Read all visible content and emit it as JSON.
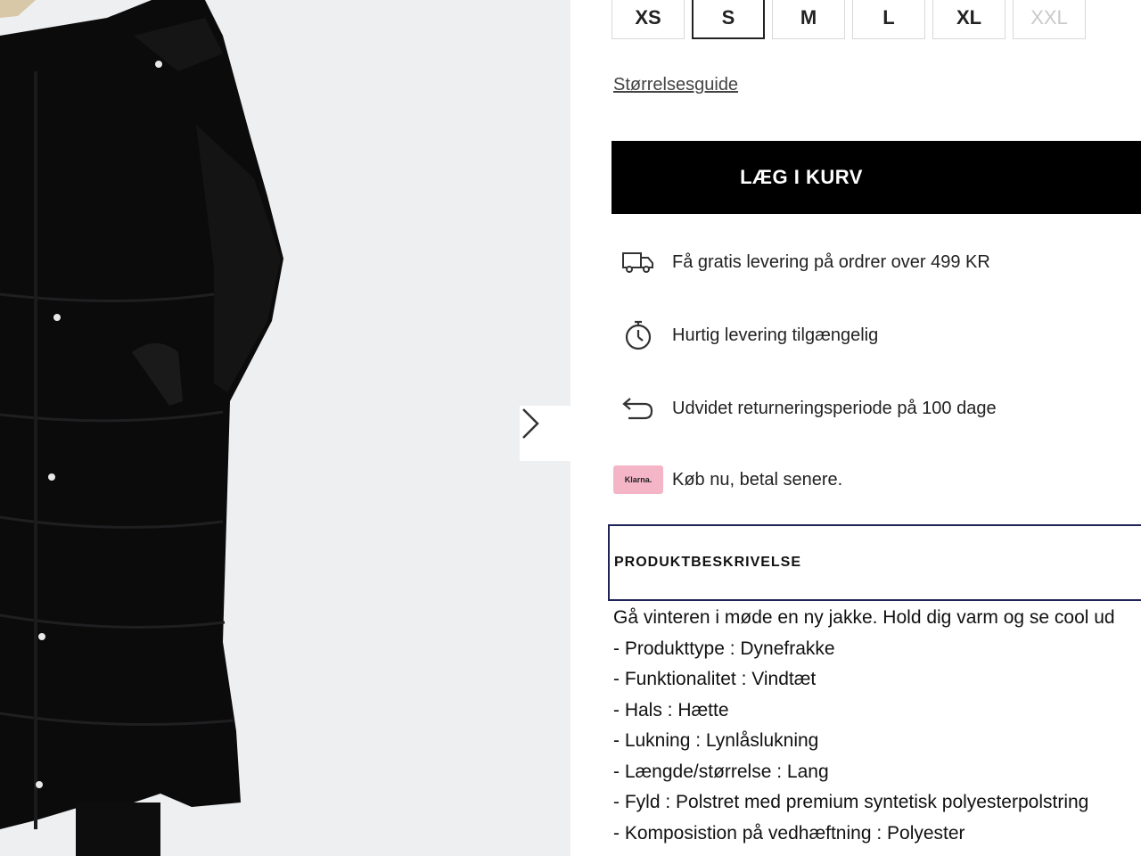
{
  "sizes": {
    "xs": "XS",
    "s": "S",
    "m": "M",
    "l": "L",
    "xl": "XL",
    "xxl": "XXL"
  },
  "size_guide": "Størrelsesguide",
  "add_to_cart": "LÆG I KURV",
  "perks": {
    "delivery": "Få gratis levering på ordrer over 499 KR",
    "fast": "Hurtig levering tilgængelig",
    "returns": "Udvidet returneringsperiode på 100 dage",
    "klarna_badge": "Klarna.",
    "klarna": "Køb nu, betal senere."
  },
  "description": {
    "header": "PRODUKTBESKRIVELSE",
    "intro": "Gå vinteren i møde en ny jakke. Hold dig varm og se cool ud",
    "lines": [
      "- Produkttype : Dynefrakke",
      "- Funktionalitet : Vindtæt",
      "- Hals : Hætte",
      "- Lukning : Lynlåslukning",
      "- Længde/størrelse : Lang",
      "- Fyld : Polstret med premium syntetisk polyesterpolstring",
      "- Komposistion på vedhæftning : Polyester"
    ]
  },
  "colors": {
    "cart_bg": "#000000",
    "desc_border": "#1f2456",
    "klarna_pink": "#f4b6c7",
    "image_bg": "#eeeff0"
  },
  "icons": {
    "delivery": "truck-icon",
    "fast": "stopwatch-icon",
    "returns": "return-arrow-icon",
    "next": "chevron-right-icon"
  }
}
